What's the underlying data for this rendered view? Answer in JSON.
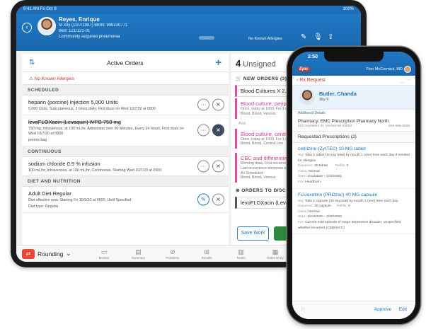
{
  "tablet": {
    "status_time": "9:41 AM  Fri Oct 9",
    "status_right": "100%",
    "patient": {
      "name": "Reyes, Enrique",
      "line1": "M 33y (10/7/1987) MRN: 999220771",
      "line2": "Bed: 121/121-01",
      "line3": "Community acquired pneumonia",
      "allergy_badge": "No Known Allergies"
    },
    "active_orders": {
      "title": "Active Orders",
      "allergy": "No Known Allergies",
      "sections": [
        {
          "heading": "SCHEDULED",
          "orders": [
            {
              "name": "heparin (porcine) injection 5,000 Units",
              "detail": "5,000 Units, Subcutaneous, 2 times daily, First dose on Wed 10/7/20 at 0900"
            },
            {
              "name": "levoFLOXacin (Levaquin) IVPB 750 mg",
              "detail": "750 mg, Intravenous, at 100 mL/hr, Administer over 90 Minutes, Every 24 hours, First dose on Wed 10/7/20 at 0800",
              "detail2": "premix bag"
            }
          ]
        },
        {
          "heading": "CONTINUOUS",
          "orders": [
            {
              "name": "sodium chloride 0.9 % infusion",
              "detail": "100 mL/hr, Intravenous, at 100 mL/hr, Continuous, Starting Wed 10/7/20 at 0900"
            }
          ]
        },
        {
          "heading": "DIET AND NUTRITION",
          "orders": [
            {
              "name": "Adult Diet Regular",
              "detail": "Diet effective now, Starting Fri 10/9/20 at 0600, Until Specified",
              "detail2": "Diet type: Regular"
            }
          ]
        }
      ]
    },
    "unsigned": {
      "count": "4",
      "label": "Unsigned",
      "new_orders_heading": "NEW ORDERS (3)",
      "cards": [
        {
          "title": "Blood Cultures X 2, Peripheral"
        },
        {
          "title": "Blood culture, peripheral",
          "detail": "Once, today at 1000, For 1 occurrence",
          "detail2": "Blood, Blood, Venous"
        },
        {
          "and": "And"
        },
        {
          "title": "Blood culture, central",
          "detail": "Once, today at 1000, For 1 occurrence",
          "detail2": "Blood, Blood, Central Line"
        },
        {
          "title": "CBC and differential",
          "detail": "Morning draw, First occurrence tomorrow",
          "detail2": "Last occurrence tomorrow at 0600",
          "detail3": "As Scheduled",
          "detail4": "Blood, Blood, Venous"
        }
      ],
      "discontinue_heading": "ORDERS TO DISCONTINUE",
      "discontinue_item": "levoFLOXacin (Levaquin) IVPB",
      "save_label": "Save Work"
    },
    "tabbar": {
      "rounding_label": "Rounding",
      "tabs": [
        "Monitor",
        "Summary",
        "Problems",
        "Results",
        "Notes",
        "Notes Entry",
        "Orders",
        "More"
      ]
    }
  },
  "phone": {
    "time": "2:50",
    "brand": "Epic",
    "user": "Finn McCormick, MD",
    "back_label": "Rx Request",
    "patient_name": "Butler, Chanda",
    "patient_age": "36y F",
    "additional": "Additional Details",
    "pharmacy_label": "Pharmacy:",
    "pharmacy_name": "EMC Prescription Pharmacy North",
    "pharmacy_address": "123 Anywhere St, Verona WI 53593",
    "pharmacy_phone": "555-555-5555",
    "requested_heading": "Requested Prescriptions (2)",
    "prescriptions": [
      {
        "name": "cetirizine (ZyrTEC) 10 MG tablet",
        "sig": "Take 1 tablet (10 mg total) by mouth 1 (one) time each day if needed for allergies",
        "dispense": "30 tablet",
        "refills": "0",
        "class": "Normal",
        "start": "1/21/2020 – 1/20/2021",
        "for": "Heartburn"
      },
      {
        "name": "FLUoxetine (PROzac) 40 MG capsule",
        "sig": "Take 1 capsule (40 mg total) by mouth 1 (one) time each day.",
        "dispense": "30 capsule",
        "refills": "0",
        "class": "Normal",
        "start": "1/21/2020 – 2/20/2020",
        "for": "Current mild episode of major depressive disorder, unspecified whether recurrent (CMS/HCC)"
      }
    ],
    "labels": {
      "sig": "Sig:",
      "dispense": "Dispense:",
      "refills": "Refills:",
      "class": "Class:",
      "start": "Start:",
      "for": "For:"
    },
    "approve_label": "Approve",
    "edit_label": "Edit"
  }
}
